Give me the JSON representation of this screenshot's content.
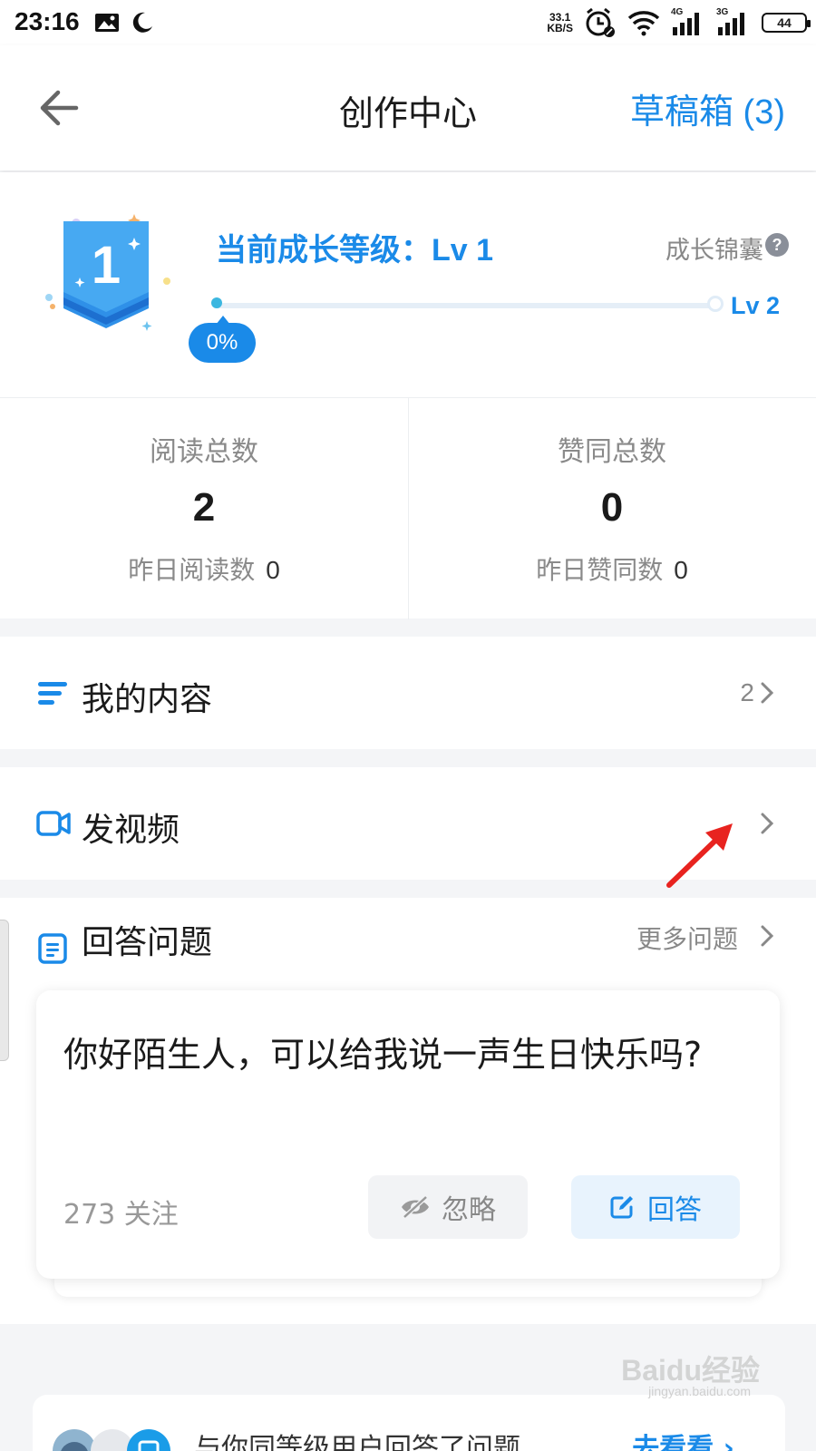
{
  "status_bar": {
    "time": "23:16",
    "net_speed_value": "33.1",
    "net_speed_unit": "KB/S",
    "signal1_label": "4G",
    "signal2_label": "3G",
    "battery": "44"
  },
  "nav": {
    "title": "创作中心",
    "drafts_label": "草稿箱 (3)"
  },
  "level": {
    "badge_number": "1",
    "title_prefix": "当前成长等级：",
    "current_level": "Lv 1",
    "tips_label": "成长锦囊",
    "help_glyph": "?",
    "progress_text": "0%",
    "progress_fraction": 0,
    "next_level": "Lv 2"
  },
  "stats": [
    {
      "label": "阅读总数",
      "value": "2",
      "sub_label": "昨日阅读数",
      "sub_value": "0"
    },
    {
      "label": "赞同总数",
      "value": "0",
      "sub_label": "昨日赞同数",
      "sub_value": "0"
    }
  ],
  "rows": {
    "my_content": {
      "label": "我的内容",
      "count": "2",
      "icon": "list-icon"
    },
    "post_video": {
      "label": "发视频",
      "icon": "video-camera-icon"
    }
  },
  "answer_section": {
    "title": "回答问题",
    "more_label": "更多问题",
    "question": {
      "text": "你好陌生人，可以给我说一声生日快乐吗?",
      "followers": "273 关注",
      "ignore_label": "忽略",
      "answer_label": "回答"
    }
  },
  "promo": {
    "text": "与你同等级用户回答了问题",
    "link": "去看看 ›"
  },
  "watermark": {
    "brand": "Baidu经验",
    "url": "jingyan.baidu.com"
  },
  "colors": {
    "accent": "#1a8ae8",
    "annotation_arrow": "#e8231f"
  }
}
